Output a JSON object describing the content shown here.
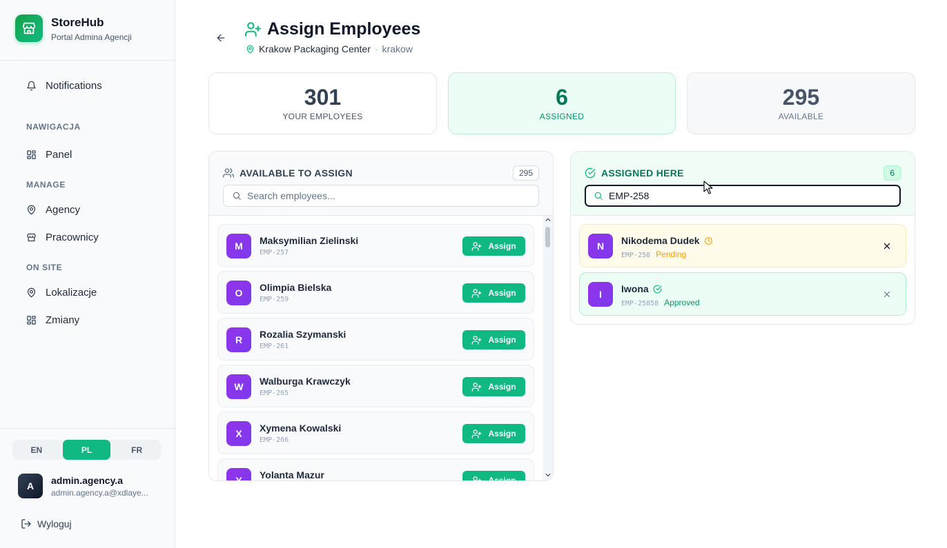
{
  "brand": {
    "name": "StoreHub",
    "subtitle": "Portal Admina Agencji"
  },
  "sidebar": {
    "notifications": "Notifications",
    "sections": {
      "nav": "NAWIGACJA",
      "manage": "MANAGE",
      "onsite": "ON SITE"
    },
    "items": {
      "panel": "Panel",
      "agency": "Agency",
      "workers": "Pracownicy",
      "locations": "Lokalizacje",
      "shifts": "Zmiany"
    }
  },
  "languages": {
    "en": "EN",
    "pl": "PL",
    "fr": "FR",
    "active": "PL"
  },
  "user": {
    "initial": "A",
    "name": "admin.agency.a",
    "email": "admin.agency.a@xdlaye..."
  },
  "logout": "Wyloguj",
  "header": {
    "title": "Assign Employees",
    "location": "Krakow Packaging Center",
    "separator": "·",
    "city": "krakow"
  },
  "stats": {
    "total": {
      "value": "301",
      "label": "YOUR EMPLOYEES"
    },
    "assigned": {
      "value": "6",
      "label": "ASSIGNED"
    },
    "available": {
      "value": "295",
      "label": "AVAILABLE"
    }
  },
  "available_panel": {
    "title": "AVAILABLE TO ASSIGN",
    "count": "295",
    "search_placeholder": "Search employees...",
    "assign_label": "Assign",
    "employees": [
      {
        "initial": "M",
        "name": "Maksymilian Zielinski",
        "id": "EMP-257"
      },
      {
        "initial": "O",
        "name": "Olimpia Bielska",
        "id": "EMP-259"
      },
      {
        "initial": "R",
        "name": "Rozalia Szymanski",
        "id": "EMP-261"
      },
      {
        "initial": "W",
        "name": "Walburga Krawczyk",
        "id": "EMP-265"
      },
      {
        "initial": "X",
        "name": "Xymena Kowalski",
        "id": "EMP-266"
      },
      {
        "initial": "Y",
        "name": "Yolanta Mazur",
        "id": ""
      }
    ]
  },
  "assigned_panel": {
    "title": "ASSIGNED HERE",
    "count": "6",
    "search_value": "EMP-258",
    "employees": [
      {
        "initial": "N",
        "name": "Nikodema Dudek",
        "id": "EMP-258",
        "status": "Pending"
      },
      {
        "initial": "I",
        "name": "Iwona",
        "id": "EMP-25858",
        "status": "Approved"
      }
    ]
  },
  "colors": {
    "accent": "#10b981",
    "pending": "#f59e0b",
    "approved": "#059669",
    "avatar": "#7c3aed"
  }
}
